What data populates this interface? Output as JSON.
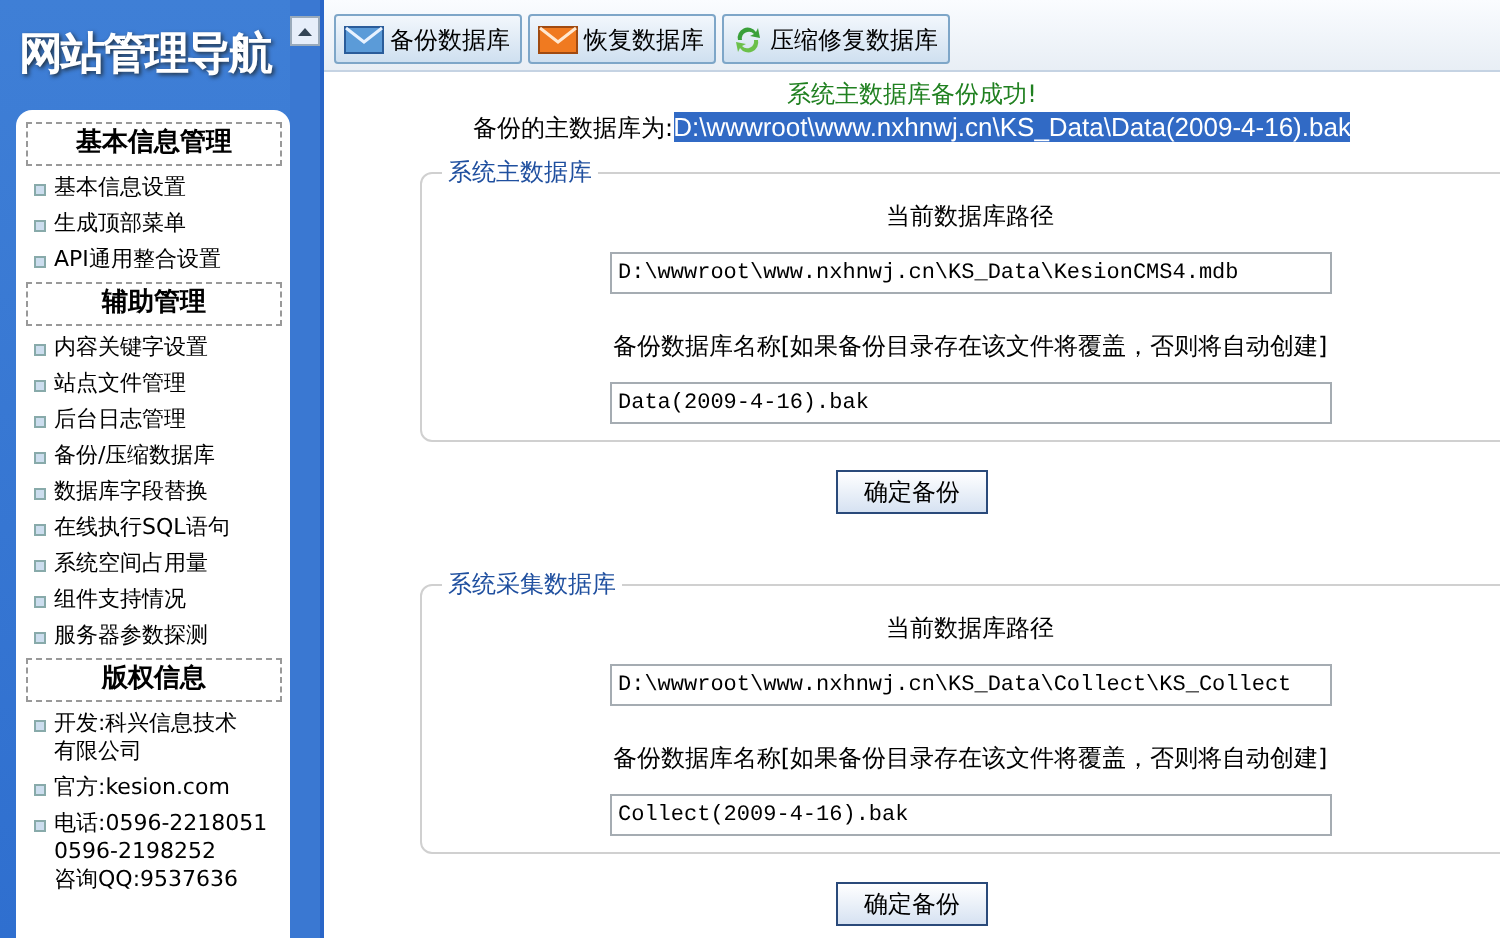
{
  "sidebar": {
    "title": "网站管理导航",
    "sections": [
      {
        "heading": "基本信息管理",
        "items": [
          {
            "lines": [
              "基本信息设置"
            ]
          },
          {
            "lines": [
              "生成顶部菜单"
            ]
          },
          {
            "lines": [
              "API通用整合设置"
            ]
          }
        ]
      },
      {
        "heading": "辅助管理",
        "items": [
          {
            "lines": [
              "内容关键字设置"
            ]
          },
          {
            "lines": [
              "站点文件管理"
            ]
          },
          {
            "lines": [
              "后台日志管理"
            ]
          },
          {
            "lines": [
              "备份/压缩数据库"
            ]
          },
          {
            "lines": [
              "数据库字段替换"
            ]
          },
          {
            "lines": [
              "在线执行SQL语句"
            ]
          },
          {
            "lines": [
              "系统空间占用量"
            ]
          },
          {
            "lines": [
              "组件支持情况"
            ]
          },
          {
            "lines": [
              "服务器参数探测"
            ]
          }
        ]
      },
      {
        "heading": "版权信息",
        "items": [
          {
            "lines": [
              "开发:科兴信息技术",
              "有限公司"
            ]
          },
          {
            "lines": [
              "官方:kesion.com"
            ]
          },
          {
            "lines": [
              "电话:0596-2218051",
              "0596-2198252",
              "咨询QQ:9537636"
            ]
          }
        ]
      }
    ]
  },
  "toolbar": {
    "buttons": [
      {
        "label": "备份数据库",
        "kind": "backup"
      },
      {
        "label": "恢复数据库",
        "kind": "restore"
      },
      {
        "label": "压缩修复数据库",
        "kind": "compact"
      }
    ]
  },
  "result": {
    "message": "系统主数据库备份成功!",
    "label": "备份的主数据库为:",
    "path": "D:\\wwwroot\\www.nxhnwj.cn\\KS_Data\\Data(2009-4-16).bak"
  },
  "groups": [
    {
      "legend": "系统主数据库",
      "path_label": "当前数据库路径",
      "path_value": "D:\\wwwroot\\www.nxhnwj.cn\\KS_Data\\KesionCMS4.mdb",
      "name_label": "备份数据库名称[如果备份目录存在该文件将覆盖，否则将自动创建]",
      "name_value": "Data(2009-4-16).bak",
      "button": "确定备份"
    },
    {
      "legend": "系统采集数据库",
      "path_label": "当前数据库路径",
      "path_value": "D:\\wwwroot\\www.nxhnwj.cn\\KS_Data\\Collect\\KS_Collect",
      "name_label": "备份数据库名称[如果备份目录存在该文件将覆盖，否则将自动创建]",
      "name_value": "Collect(2009-4-16).bak",
      "button": "确定备份"
    }
  ]
}
